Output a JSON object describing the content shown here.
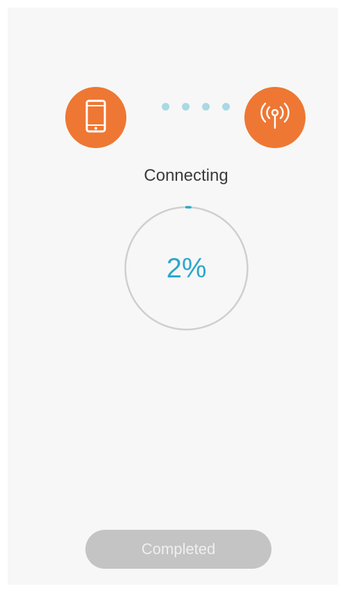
{
  "status": {
    "text": "Connecting"
  },
  "progress": {
    "percent_label": "2%",
    "value_fraction": 0.02
  },
  "devices": {
    "source_icon": "smartphone-icon",
    "target_icon": "router-signal-icon",
    "dot_count": 4
  },
  "footer": {
    "completed_label": "Completed"
  },
  "colors": {
    "accent_orange": "#ee7733",
    "progress_blue": "#2da6cc",
    "dot_blue": "#a9d9e4",
    "ring_gray": "#cfcfcf",
    "button_disabled": "#c4c4c4"
  }
}
